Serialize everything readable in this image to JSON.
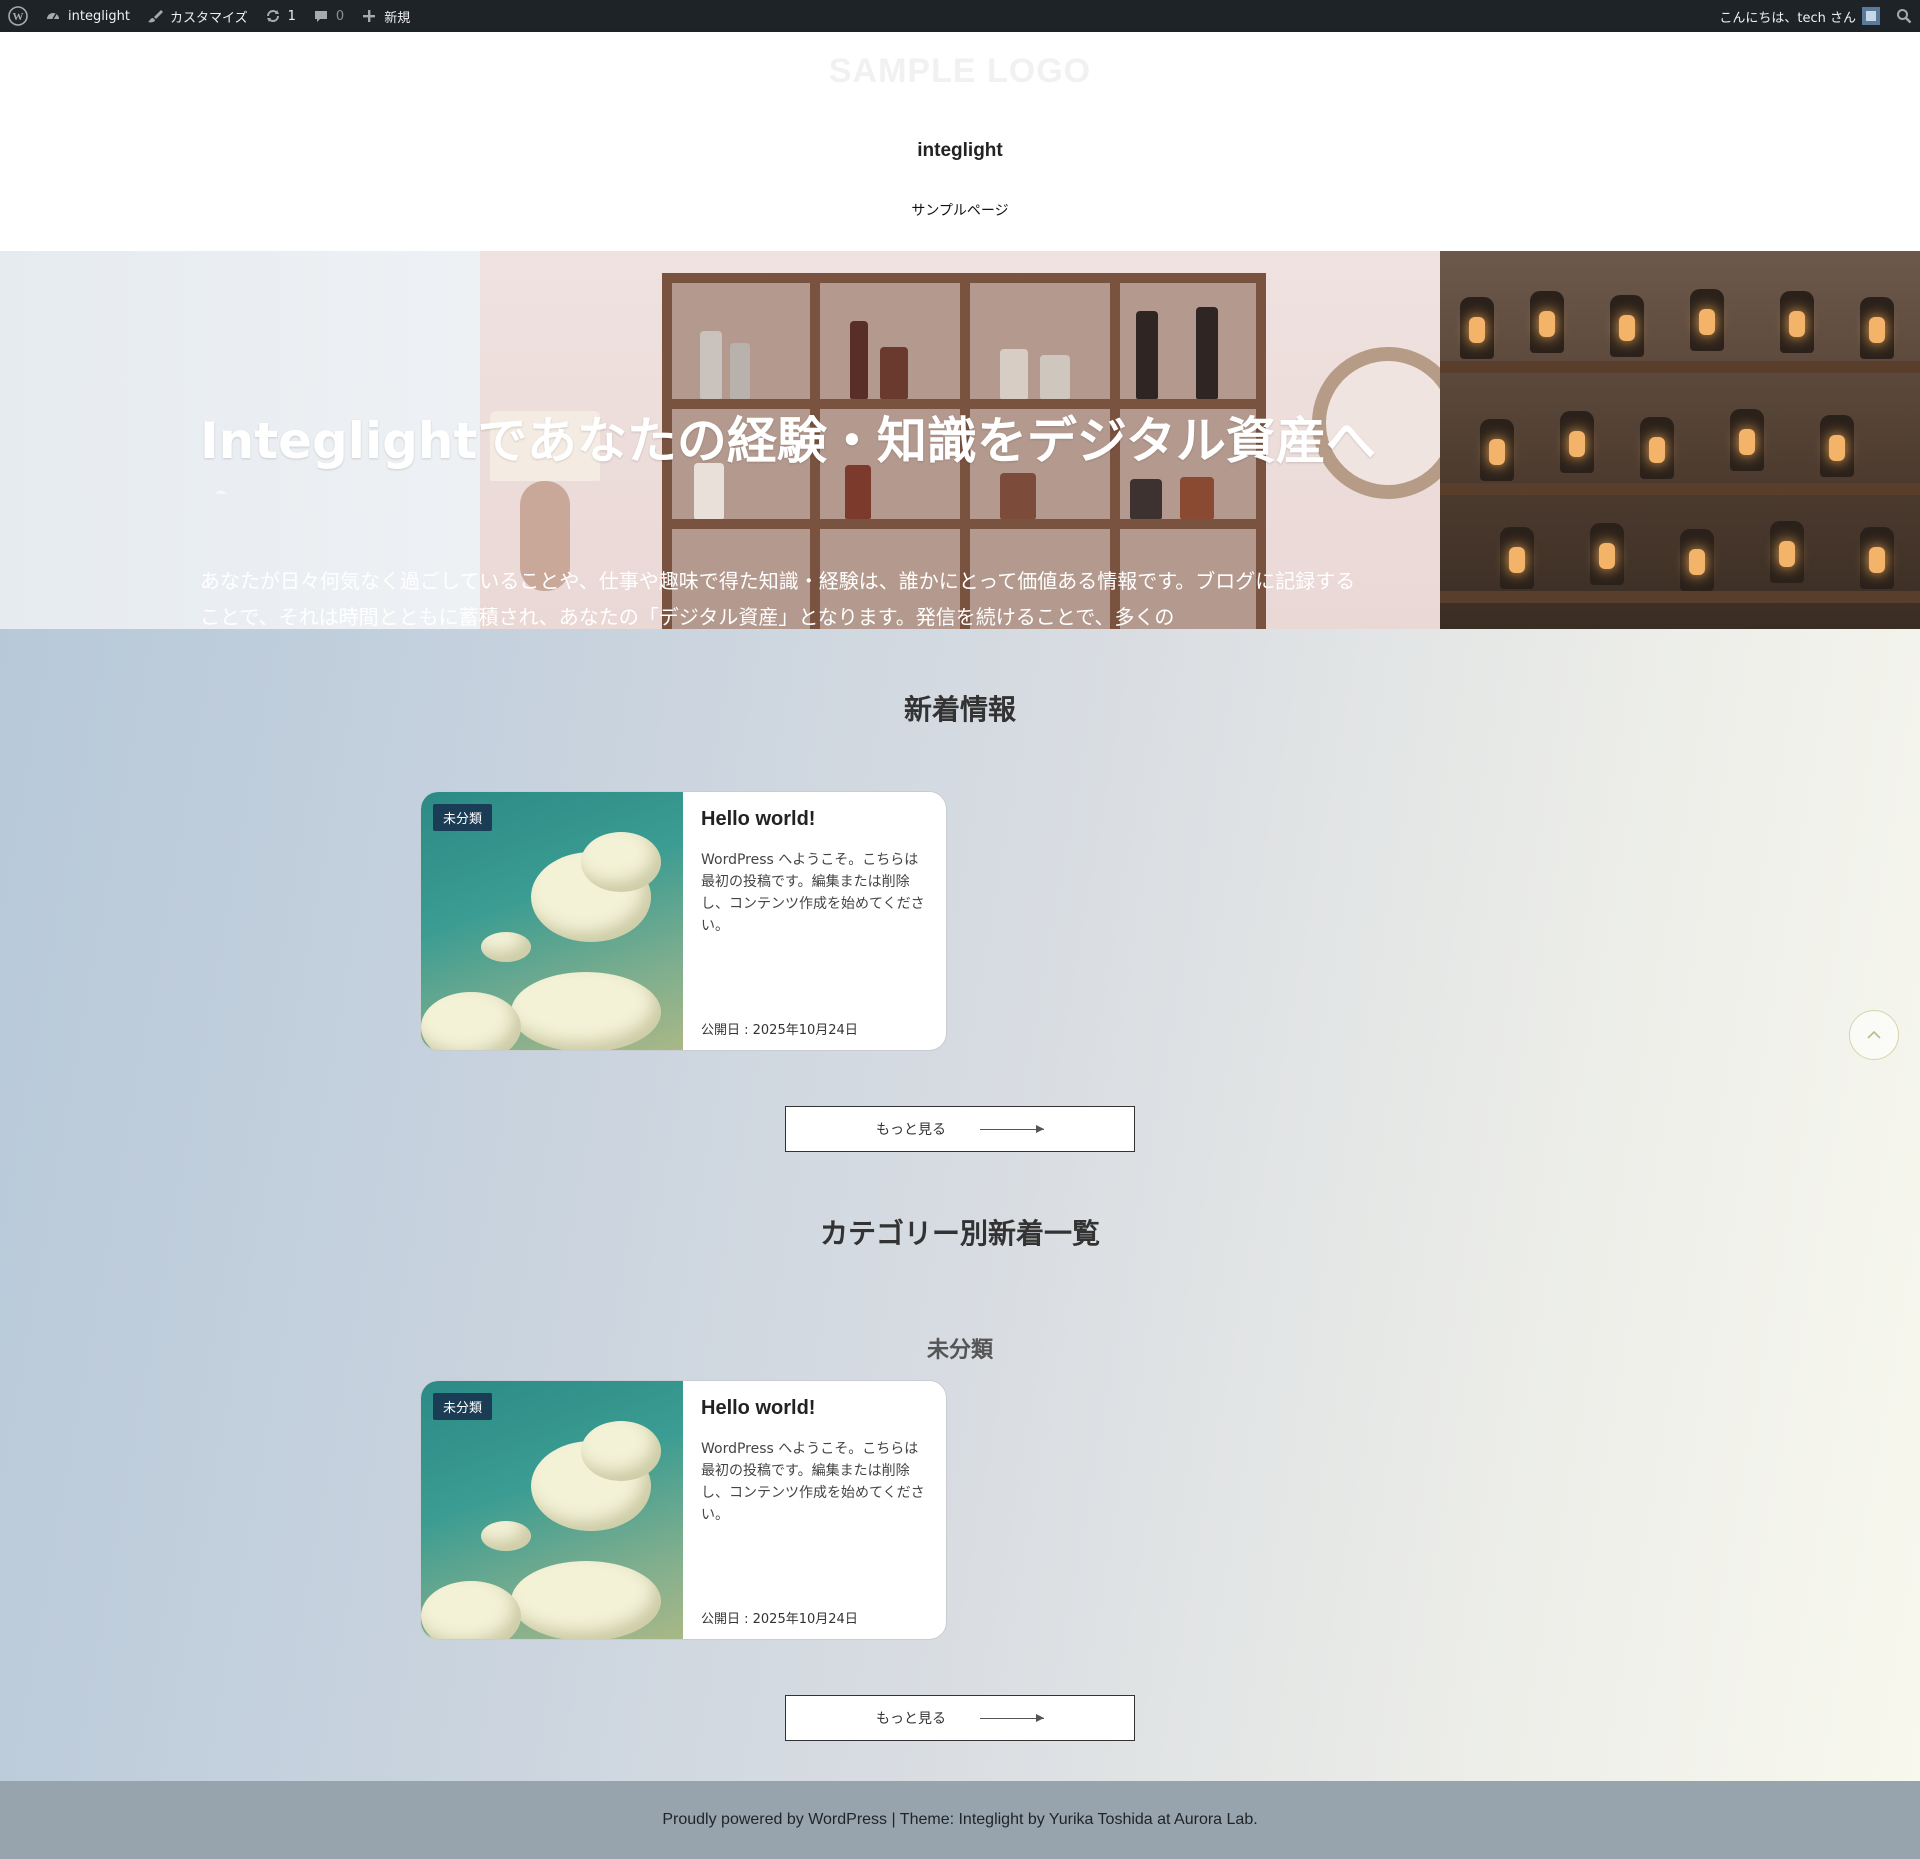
{
  "admin_bar": {
    "site_name": "integlight",
    "customize": "カスタマイズ",
    "updates_count": "1",
    "comments_count": "0",
    "new_label": "新規",
    "greeting": "こんにちは、tech さん",
    "icons": [
      "wordpress-logo-icon",
      "dashboard-icon",
      "brush-icon",
      "updates-icon",
      "comment-icon",
      "plus-icon",
      "search-icon"
    ]
  },
  "header": {
    "logo_text": "SAMPLE LOGO",
    "site_title": "integlight",
    "nav": [
      {
        "label": "サンプルページ"
      }
    ]
  },
  "hero": {
    "title": "Integlightであなたの経験・知識をデジタル資産へ",
    "title_overflow": "へ",
    "lead": "あなたが日々何気なく過ごしていることや、仕事や趣味で得た知識・経験は、誰かにとって価値ある情報です。ブログに記録することで、それは時間とともに蓄積され、あなたの「デジタル資産」となります。発信を続けることで、多くの"
  },
  "sections": {
    "latest_title": "新着情報",
    "category_title": "カテゴリー別新着一覧",
    "category_name": "未分類",
    "more_label": "もっと見る"
  },
  "posts": [
    {
      "category": "未分類",
      "title": "Hello world!",
      "excerpt": "WordPress へようこそ。こちらは最初の投稿です。編集または削除し、コンテンツ作成を始めてください。",
      "date": "公開日 : 2025年10月24日"
    },
    {
      "category": "未分類",
      "title": "Hello world!",
      "excerpt": "WordPress へようこそ。こちらは最初の投稿です。編集または削除し、コンテンツ作成を始めてください。",
      "date": "公開日 : 2025年10月24日"
    }
  ],
  "scroll_top_icon": "chevron-up-icon",
  "footer": {
    "text": "Proudly powered by WordPress | Theme: Integlight by Yurika Toshida at Aurora Lab."
  },
  "colors": {
    "admin_bar": "#1d2327",
    "category_badge": "#1b3c55",
    "footer_bg": "#97a3ad"
  }
}
